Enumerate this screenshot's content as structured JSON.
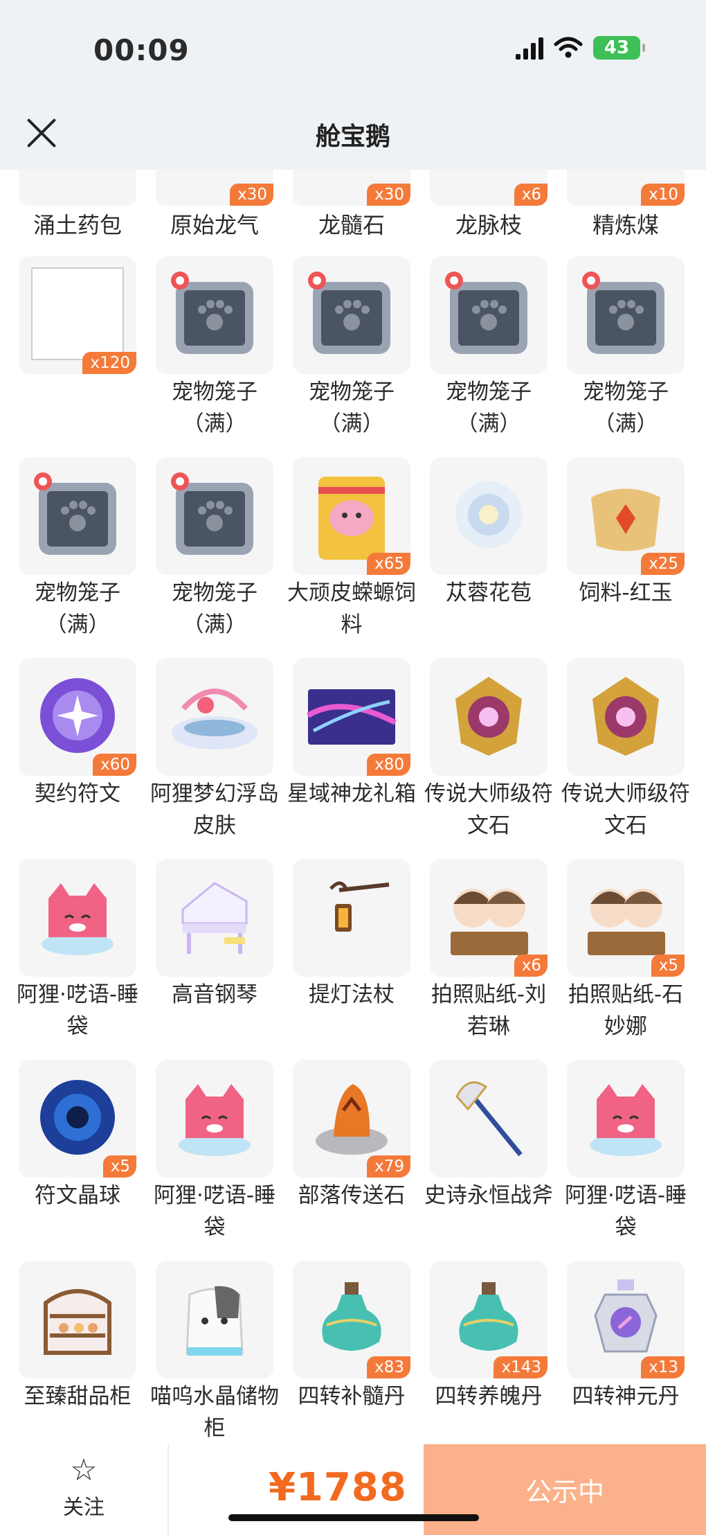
{
  "status_bar": {
    "time": "00:09",
    "battery": "43"
  },
  "header": {
    "title": "舱宝鹅"
  },
  "partial_row": [
    {
      "name": "涌土药包",
      "badge": ""
    },
    {
      "name": "原始龙气",
      "badge": "x30"
    },
    {
      "name": "龙髓石",
      "badge": "x30"
    },
    {
      "name": "龙脉枝",
      "badge": "x6"
    },
    {
      "name": "精炼煤",
      "badge": "x10"
    }
  ],
  "items": [
    {
      "name": "",
      "badge": "x120",
      "icon": "blank-frame-icon"
    },
    {
      "name": "宠物笼子（满）",
      "badge": "",
      "icon": "pet-cage-icon"
    },
    {
      "name": "宠物笼子（满）",
      "badge": "",
      "icon": "pet-cage-icon"
    },
    {
      "name": "宠物笼子（满）",
      "badge": "",
      "icon": "pet-cage-icon"
    },
    {
      "name": "宠物笼子（满）",
      "badge": "",
      "icon": "pet-cage-icon"
    },
    {
      "name": "宠物笼子（满）",
      "badge": "",
      "icon": "pet-cage-icon"
    },
    {
      "name": "宠物笼子（满）",
      "badge": "",
      "icon": "pet-cage-icon"
    },
    {
      "name": "大顽皮蝾螈饲料",
      "badge": "x65",
      "icon": "feed-bag-icon"
    },
    {
      "name": "苁蓉花苞",
      "badge": "",
      "icon": "flower-bud-icon"
    },
    {
      "name": "饲料-红玉",
      "badge": "x25",
      "icon": "ruby-feed-icon"
    },
    {
      "name": "契约符文",
      "badge": "x60",
      "icon": "contract-rune-icon"
    },
    {
      "name": "阿狸梦幻浮岛皮肤",
      "badge": "",
      "icon": "floating-island-icon"
    },
    {
      "name": "星域神龙礼箱",
      "badge": "x80",
      "icon": "dragon-gift-box-icon"
    },
    {
      "name": "传说大师级符文石",
      "badge": "",
      "icon": "rune-stone-icon"
    },
    {
      "name": "传说大师级符文石",
      "badge": "",
      "icon": "rune-stone-icon"
    },
    {
      "name": "阿狸·呓语-睡袋",
      "badge": "",
      "icon": "fox-sleeping-bag-icon"
    },
    {
      "name": "高音钢琴",
      "badge": "",
      "icon": "piano-icon"
    },
    {
      "name": "提灯法杖",
      "badge": "",
      "icon": "lantern-staff-icon"
    },
    {
      "name": "拍照贴纸-刘若琳",
      "badge": "x6",
      "icon": "photo-sticker-icon"
    },
    {
      "name": "拍照贴纸-石妙娜",
      "badge": "x5",
      "icon": "photo-sticker-icon"
    },
    {
      "name": "符文晶球",
      "badge": "x5",
      "icon": "rune-orb-icon"
    },
    {
      "name": "阿狸·呓语-睡袋",
      "badge": "",
      "icon": "fox-sleeping-bag-icon"
    },
    {
      "name": "部落传送石",
      "badge": "x79",
      "icon": "teleport-stone-icon"
    },
    {
      "name": "史诗永恒战斧",
      "badge": "",
      "icon": "battle-axe-icon"
    },
    {
      "name": "阿狸·呓语-睡袋",
      "badge": "",
      "icon": "fox-sleeping-bag-icon"
    },
    {
      "name": "至臻甜品柜",
      "badge": "",
      "icon": "dessert-cabinet-icon"
    },
    {
      "name": "喵呜水晶储物柜",
      "badge": "",
      "icon": "cat-cabinet-icon"
    },
    {
      "name": "四转补髓丹",
      "badge": "x83",
      "icon": "potion-bottle-icon"
    },
    {
      "name": "四转养魄丹",
      "badge": "x143",
      "icon": "potion-bottle-icon"
    },
    {
      "name": "四转神元丹",
      "badge": "x13",
      "icon": "crystal-bottle-icon"
    }
  ],
  "bottom_bar": {
    "follow_label": "关注",
    "price": "¥1788",
    "status_label": "公示中"
  },
  "colors": {
    "accent": "#f26a1f",
    "badge": "#f47a3a",
    "status_button": "#fbb18a"
  }
}
